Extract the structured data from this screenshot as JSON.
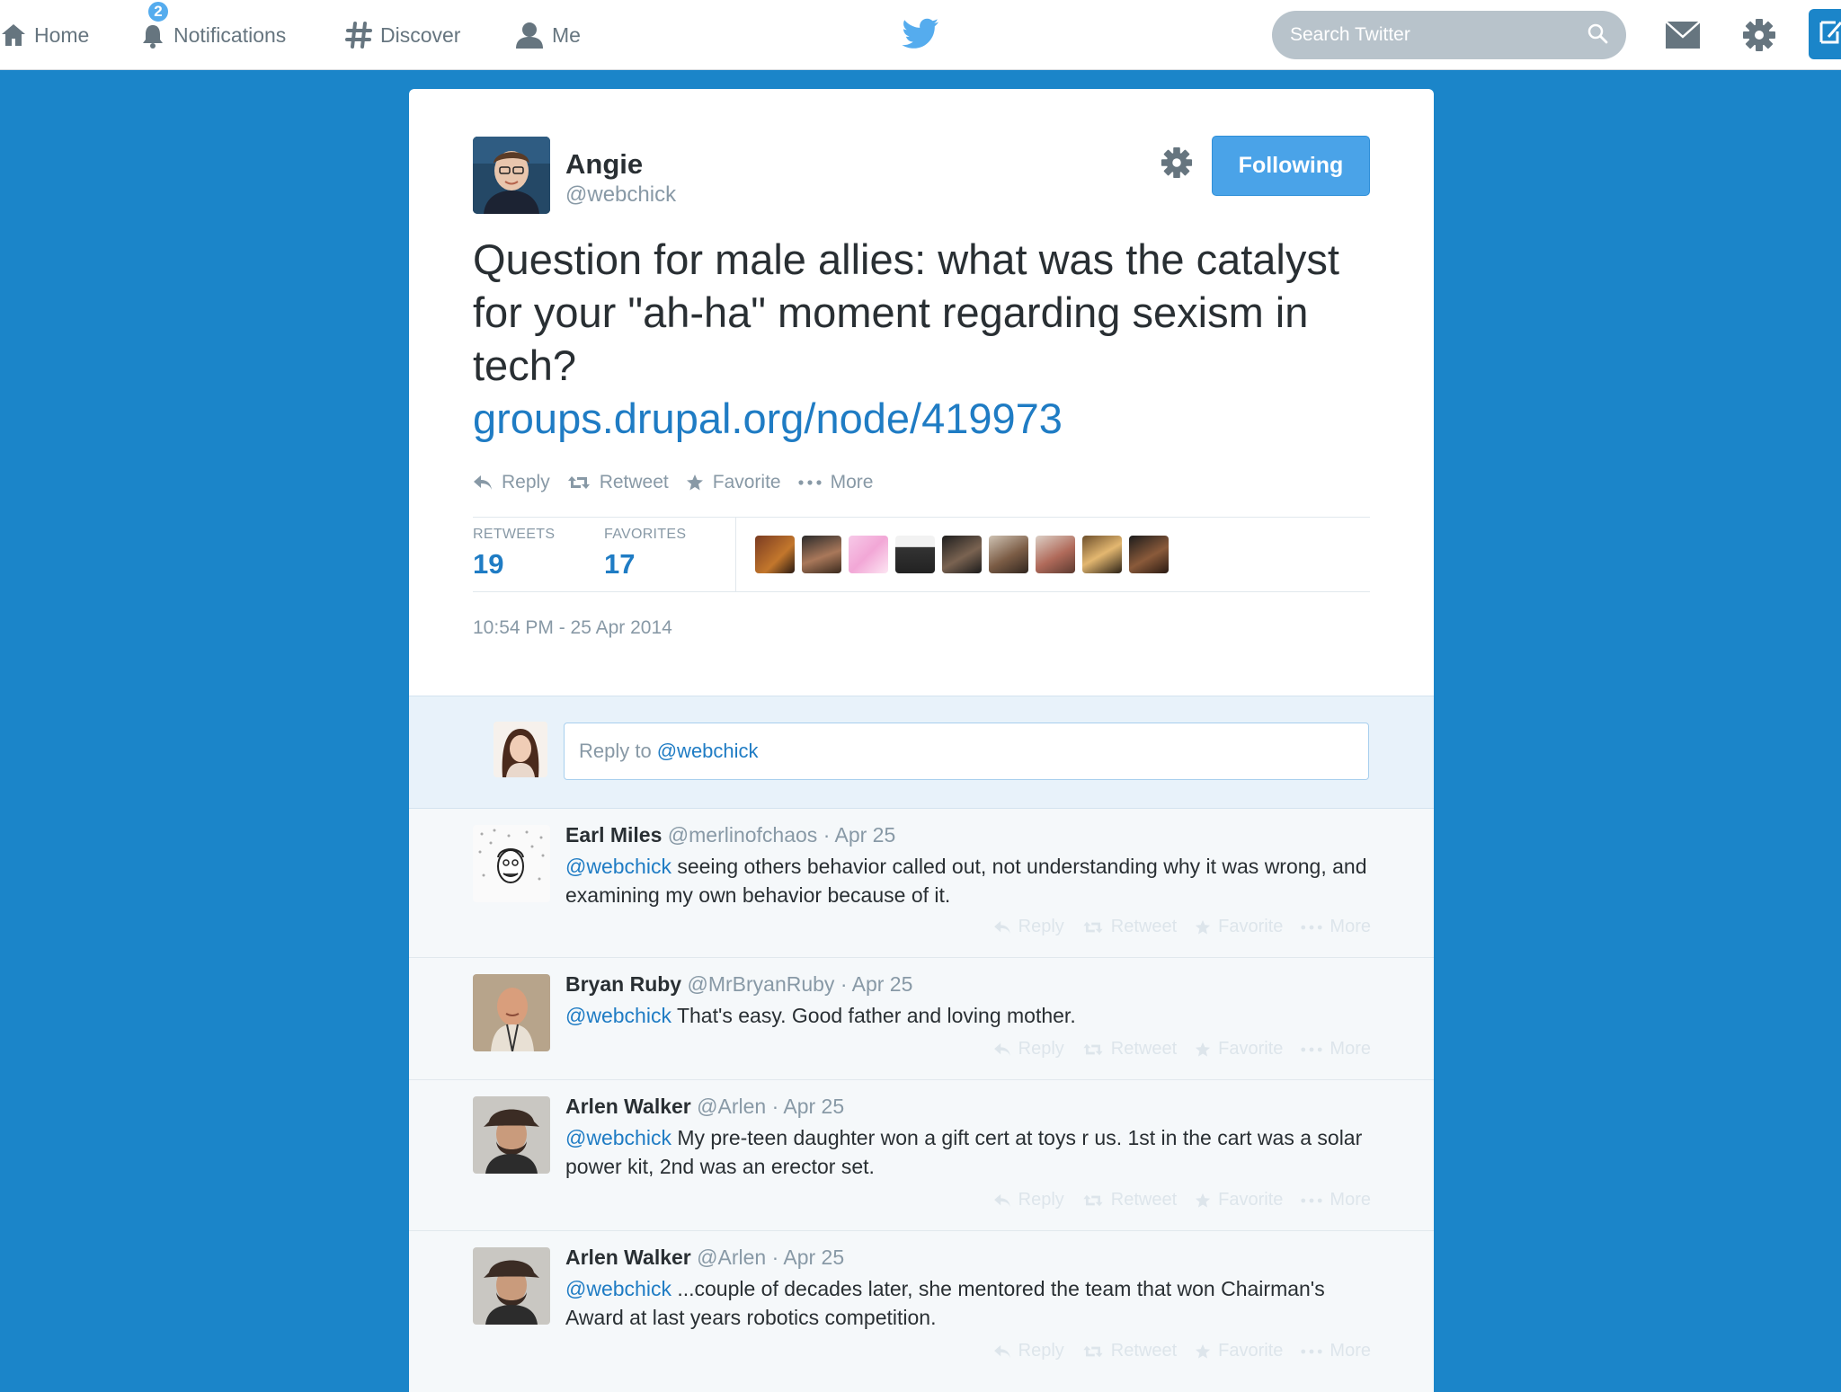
{
  "nav": {
    "home": "Home",
    "notifications": "Notifications",
    "notifications_badge": "2",
    "discover": "Discover",
    "me": "Me",
    "search_placeholder": "Search Twitter"
  },
  "colors": {
    "background": "#1b85c9",
    "link": "#1f7cc4",
    "follow_button": "#4aa3e8",
    "muted": "#8899a6"
  },
  "tweet": {
    "author_name": "Angie",
    "author_handle": "@webchick",
    "follow_label": "Following",
    "text": "Question for male allies: what was the catalyst for your \"ah-ha\" moment regarding sexism in tech?",
    "link": "groups.drupal.org/node/419973",
    "actions": {
      "reply": "Reply",
      "retweet": "Retweet",
      "favorite": "Favorite",
      "more": "More"
    },
    "stats": {
      "retweets_label": "RETWEETS",
      "retweets_value": "19",
      "favorites_label": "FAVORITES",
      "favorites_value": "17"
    },
    "timestamp": "10:54 PM - 25 Apr 2014"
  },
  "reply_box": {
    "prefix": "Reply to",
    "mention": "@webchick"
  },
  "replies": [
    {
      "name": "Earl Miles",
      "meta": "@merlinofchaos · Apr 25",
      "mention": "@webchick",
      "text": "seeing others behavior called out, not understanding why it was wrong, and examining my own behavior because of it."
    },
    {
      "name": "Bryan Ruby",
      "meta": "@MrBryanRuby · Apr 25",
      "mention": "@webchick",
      "text": "That's easy. Good father and loving mother."
    },
    {
      "name": "Arlen Walker",
      "meta": "@Arlen · Apr 25",
      "mention": "@webchick",
      "text": "My pre-teen daughter won a gift cert at toys r us. 1st in the cart was a solar power kit, 2nd was an erector set."
    },
    {
      "name": "Arlen Walker",
      "meta": "@Arlen · Apr 25",
      "mention": "@webchick",
      "text": "...couple of decades later, she mentored the team that won Chairman's Award at last years robotics competition."
    }
  ]
}
